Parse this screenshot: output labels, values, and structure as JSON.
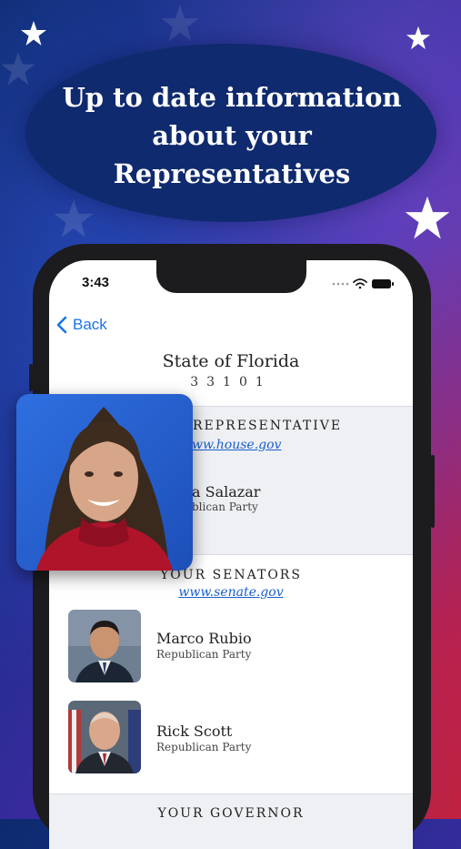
{
  "promo": {
    "headline_line1": "Up to date information",
    "headline_line2": "about your",
    "headline_line3": "Representatives"
  },
  "status_bar": {
    "time": "3:43"
  },
  "nav": {
    "back_label": "Back"
  },
  "location": {
    "state": "State of Florida",
    "zip": "33101"
  },
  "representative": {
    "heading_partial": "REPRESENTATIVE",
    "link_partial": "ww.house.gov",
    "name_partial": "a Salazar",
    "party_partial": "blican Party"
  },
  "senators": {
    "heading": "YOUR SENATORS",
    "link": "www.senate.gov",
    "people": [
      {
        "name": "Marco Rubio",
        "party": "Republican Party"
      },
      {
        "name": "Rick Scott",
        "party": "Republican Party"
      }
    ]
  },
  "governor": {
    "heading": "YOUR GOVERNOR"
  },
  "colors": {
    "accent_blue": "#1a73e8",
    "link_blue": "#1a5fd0",
    "headline_bubble": "#0f2a6e"
  }
}
